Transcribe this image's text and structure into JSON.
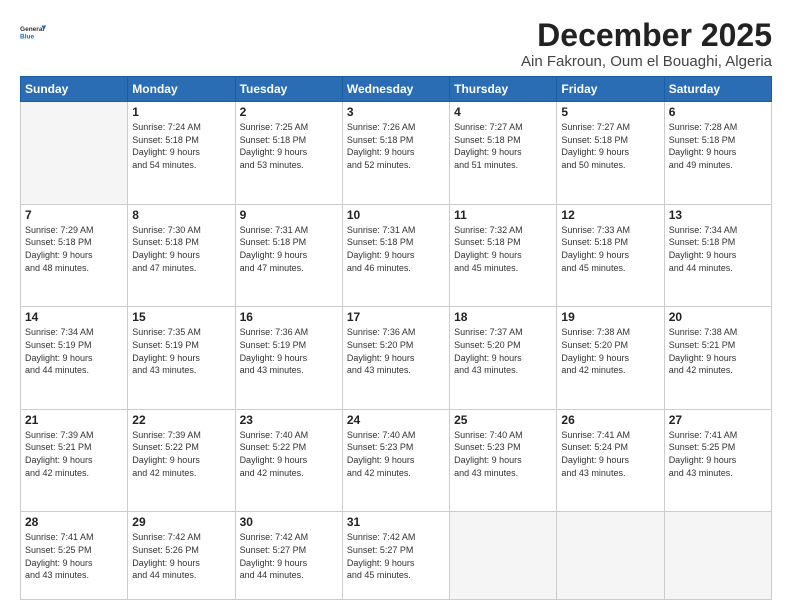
{
  "header": {
    "logo_line1": "General",
    "logo_line2": "Blue",
    "month": "December 2025",
    "location": "Ain Fakroun, Oum el Bouaghi, Algeria"
  },
  "days_of_week": [
    "Sunday",
    "Monday",
    "Tuesday",
    "Wednesday",
    "Thursday",
    "Friday",
    "Saturday"
  ],
  "weeks": [
    [
      {
        "day": "",
        "info": ""
      },
      {
        "day": "1",
        "info": "Sunrise: 7:24 AM\nSunset: 5:18 PM\nDaylight: 9 hours\nand 54 minutes."
      },
      {
        "day": "2",
        "info": "Sunrise: 7:25 AM\nSunset: 5:18 PM\nDaylight: 9 hours\nand 53 minutes."
      },
      {
        "day": "3",
        "info": "Sunrise: 7:26 AM\nSunset: 5:18 PM\nDaylight: 9 hours\nand 52 minutes."
      },
      {
        "day": "4",
        "info": "Sunrise: 7:27 AM\nSunset: 5:18 PM\nDaylight: 9 hours\nand 51 minutes."
      },
      {
        "day": "5",
        "info": "Sunrise: 7:27 AM\nSunset: 5:18 PM\nDaylight: 9 hours\nand 50 minutes."
      },
      {
        "day": "6",
        "info": "Sunrise: 7:28 AM\nSunset: 5:18 PM\nDaylight: 9 hours\nand 49 minutes."
      }
    ],
    [
      {
        "day": "7",
        "info": "Sunrise: 7:29 AM\nSunset: 5:18 PM\nDaylight: 9 hours\nand 48 minutes."
      },
      {
        "day": "8",
        "info": "Sunrise: 7:30 AM\nSunset: 5:18 PM\nDaylight: 9 hours\nand 47 minutes."
      },
      {
        "day": "9",
        "info": "Sunrise: 7:31 AM\nSunset: 5:18 PM\nDaylight: 9 hours\nand 47 minutes."
      },
      {
        "day": "10",
        "info": "Sunrise: 7:31 AM\nSunset: 5:18 PM\nDaylight: 9 hours\nand 46 minutes."
      },
      {
        "day": "11",
        "info": "Sunrise: 7:32 AM\nSunset: 5:18 PM\nDaylight: 9 hours\nand 45 minutes."
      },
      {
        "day": "12",
        "info": "Sunrise: 7:33 AM\nSunset: 5:18 PM\nDaylight: 9 hours\nand 45 minutes."
      },
      {
        "day": "13",
        "info": "Sunrise: 7:34 AM\nSunset: 5:18 PM\nDaylight: 9 hours\nand 44 minutes."
      }
    ],
    [
      {
        "day": "14",
        "info": "Sunrise: 7:34 AM\nSunset: 5:19 PM\nDaylight: 9 hours\nand 44 minutes."
      },
      {
        "day": "15",
        "info": "Sunrise: 7:35 AM\nSunset: 5:19 PM\nDaylight: 9 hours\nand 43 minutes."
      },
      {
        "day": "16",
        "info": "Sunrise: 7:36 AM\nSunset: 5:19 PM\nDaylight: 9 hours\nand 43 minutes."
      },
      {
        "day": "17",
        "info": "Sunrise: 7:36 AM\nSunset: 5:20 PM\nDaylight: 9 hours\nand 43 minutes."
      },
      {
        "day": "18",
        "info": "Sunrise: 7:37 AM\nSunset: 5:20 PM\nDaylight: 9 hours\nand 43 minutes."
      },
      {
        "day": "19",
        "info": "Sunrise: 7:38 AM\nSunset: 5:20 PM\nDaylight: 9 hours\nand 42 minutes."
      },
      {
        "day": "20",
        "info": "Sunrise: 7:38 AM\nSunset: 5:21 PM\nDaylight: 9 hours\nand 42 minutes."
      }
    ],
    [
      {
        "day": "21",
        "info": "Sunrise: 7:39 AM\nSunset: 5:21 PM\nDaylight: 9 hours\nand 42 minutes."
      },
      {
        "day": "22",
        "info": "Sunrise: 7:39 AM\nSunset: 5:22 PM\nDaylight: 9 hours\nand 42 minutes."
      },
      {
        "day": "23",
        "info": "Sunrise: 7:40 AM\nSunset: 5:22 PM\nDaylight: 9 hours\nand 42 minutes."
      },
      {
        "day": "24",
        "info": "Sunrise: 7:40 AM\nSunset: 5:23 PM\nDaylight: 9 hours\nand 42 minutes."
      },
      {
        "day": "25",
        "info": "Sunrise: 7:40 AM\nSunset: 5:23 PM\nDaylight: 9 hours\nand 43 minutes."
      },
      {
        "day": "26",
        "info": "Sunrise: 7:41 AM\nSunset: 5:24 PM\nDaylight: 9 hours\nand 43 minutes."
      },
      {
        "day": "27",
        "info": "Sunrise: 7:41 AM\nSunset: 5:25 PM\nDaylight: 9 hours\nand 43 minutes."
      }
    ],
    [
      {
        "day": "28",
        "info": "Sunrise: 7:41 AM\nSunset: 5:25 PM\nDaylight: 9 hours\nand 43 minutes."
      },
      {
        "day": "29",
        "info": "Sunrise: 7:42 AM\nSunset: 5:26 PM\nDaylight: 9 hours\nand 44 minutes."
      },
      {
        "day": "30",
        "info": "Sunrise: 7:42 AM\nSunset: 5:27 PM\nDaylight: 9 hours\nand 44 minutes."
      },
      {
        "day": "31",
        "info": "Sunrise: 7:42 AM\nSunset: 5:27 PM\nDaylight: 9 hours\nand 45 minutes."
      },
      {
        "day": "",
        "info": ""
      },
      {
        "day": "",
        "info": ""
      },
      {
        "day": "",
        "info": ""
      }
    ]
  ]
}
